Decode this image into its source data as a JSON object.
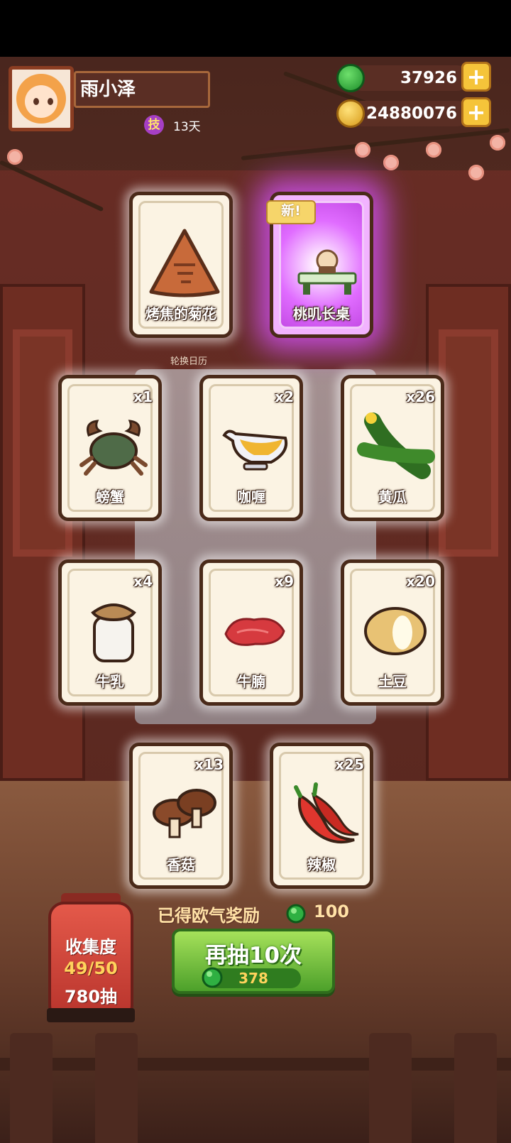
{
  "profile": {
    "name": "雨小泽",
    "skill_icon_text": "技",
    "days": "13天"
  },
  "currency": {
    "jade": {
      "value": "37926",
      "icon": "jade-icon"
    },
    "coin": {
      "value": "24880076",
      "icon": "coin-icon"
    },
    "plus": "+"
  },
  "top_cards": [
    {
      "label": "烤焦的菊花",
      "icon": "burnt-food-icon"
    },
    {
      "label": "桃叽长桌",
      "icon": "long-table-icon",
      "badge": "新!"
    }
  ],
  "sign_text": "轮换日历",
  "item_cards": [
    {
      "label": "螃蟹",
      "count": "x1",
      "icon": "crab-icon"
    },
    {
      "label": "咖喱",
      "count": "x2",
      "icon": "curry-icon"
    },
    {
      "label": "黄瓜",
      "count": "x26",
      "icon": "cucumber-icon"
    },
    {
      "label": "牛乳",
      "count": "x4",
      "icon": "milk-icon"
    },
    {
      "label": "牛腩",
      "count": "x9",
      "icon": "beef-icon"
    },
    {
      "label": "土豆",
      "count": "x20",
      "icon": "potato-icon"
    },
    {
      "label": "香菇",
      "count": "x13",
      "icon": "mushroom-icon"
    },
    {
      "label": "辣椒",
      "count": "x25",
      "icon": "chili-icon"
    }
  ],
  "reward": {
    "label": "已得欧气奖励",
    "value": "100"
  },
  "draw_button": {
    "label": "再抽10次",
    "cost": "378"
  },
  "collection": {
    "title": "收集度",
    "progress": "49/50",
    "draws": "780抽"
  },
  "colors": {
    "card_bg": "#fbf3e3",
    "button_green": "#4ca02a",
    "special_glow": "#d652ff",
    "lantern_red": "#c8392f"
  }
}
